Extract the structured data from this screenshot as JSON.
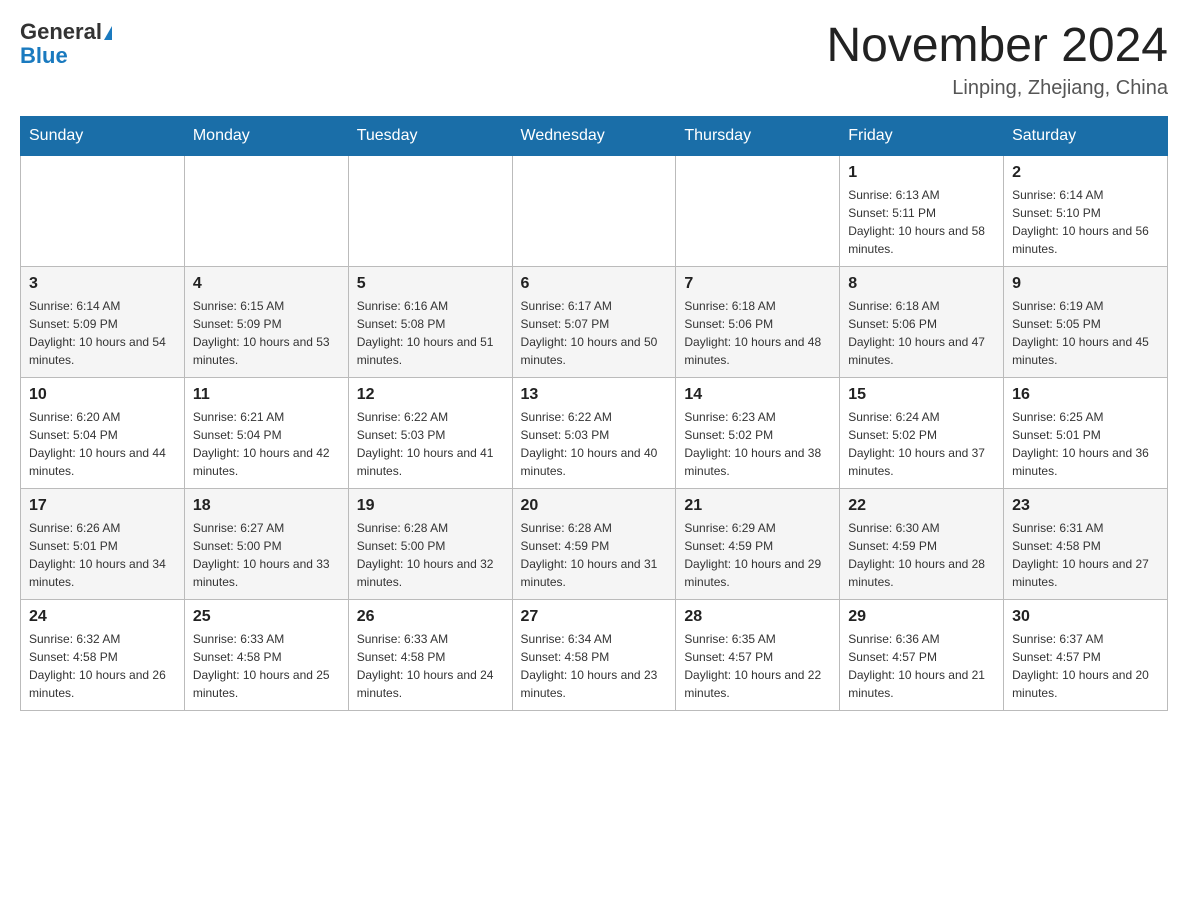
{
  "header": {
    "logo_general": "General",
    "logo_blue": "Blue",
    "month_title": "November 2024",
    "location": "Linping, Zhejiang, China"
  },
  "weekdays": [
    "Sunday",
    "Monday",
    "Tuesday",
    "Wednesday",
    "Thursday",
    "Friday",
    "Saturday"
  ],
  "weeks": [
    [
      {
        "day": "",
        "sunrise": "",
        "sunset": "",
        "daylight": ""
      },
      {
        "day": "",
        "sunrise": "",
        "sunset": "",
        "daylight": ""
      },
      {
        "day": "",
        "sunrise": "",
        "sunset": "",
        "daylight": ""
      },
      {
        "day": "",
        "sunrise": "",
        "sunset": "",
        "daylight": ""
      },
      {
        "day": "",
        "sunrise": "",
        "sunset": "",
        "daylight": ""
      },
      {
        "day": "1",
        "sunrise": "Sunrise: 6:13 AM",
        "sunset": "Sunset: 5:11 PM",
        "daylight": "Daylight: 10 hours and 58 minutes."
      },
      {
        "day": "2",
        "sunrise": "Sunrise: 6:14 AM",
        "sunset": "Sunset: 5:10 PM",
        "daylight": "Daylight: 10 hours and 56 minutes."
      }
    ],
    [
      {
        "day": "3",
        "sunrise": "Sunrise: 6:14 AM",
        "sunset": "Sunset: 5:09 PM",
        "daylight": "Daylight: 10 hours and 54 minutes."
      },
      {
        "day": "4",
        "sunrise": "Sunrise: 6:15 AM",
        "sunset": "Sunset: 5:09 PM",
        "daylight": "Daylight: 10 hours and 53 minutes."
      },
      {
        "day": "5",
        "sunrise": "Sunrise: 6:16 AM",
        "sunset": "Sunset: 5:08 PM",
        "daylight": "Daylight: 10 hours and 51 minutes."
      },
      {
        "day": "6",
        "sunrise": "Sunrise: 6:17 AM",
        "sunset": "Sunset: 5:07 PM",
        "daylight": "Daylight: 10 hours and 50 minutes."
      },
      {
        "day": "7",
        "sunrise": "Sunrise: 6:18 AM",
        "sunset": "Sunset: 5:06 PM",
        "daylight": "Daylight: 10 hours and 48 minutes."
      },
      {
        "day": "8",
        "sunrise": "Sunrise: 6:18 AM",
        "sunset": "Sunset: 5:06 PM",
        "daylight": "Daylight: 10 hours and 47 minutes."
      },
      {
        "day": "9",
        "sunrise": "Sunrise: 6:19 AM",
        "sunset": "Sunset: 5:05 PM",
        "daylight": "Daylight: 10 hours and 45 minutes."
      }
    ],
    [
      {
        "day": "10",
        "sunrise": "Sunrise: 6:20 AM",
        "sunset": "Sunset: 5:04 PM",
        "daylight": "Daylight: 10 hours and 44 minutes."
      },
      {
        "day": "11",
        "sunrise": "Sunrise: 6:21 AM",
        "sunset": "Sunset: 5:04 PM",
        "daylight": "Daylight: 10 hours and 42 minutes."
      },
      {
        "day": "12",
        "sunrise": "Sunrise: 6:22 AM",
        "sunset": "Sunset: 5:03 PM",
        "daylight": "Daylight: 10 hours and 41 minutes."
      },
      {
        "day": "13",
        "sunrise": "Sunrise: 6:22 AM",
        "sunset": "Sunset: 5:03 PM",
        "daylight": "Daylight: 10 hours and 40 minutes."
      },
      {
        "day": "14",
        "sunrise": "Sunrise: 6:23 AM",
        "sunset": "Sunset: 5:02 PM",
        "daylight": "Daylight: 10 hours and 38 minutes."
      },
      {
        "day": "15",
        "sunrise": "Sunrise: 6:24 AM",
        "sunset": "Sunset: 5:02 PM",
        "daylight": "Daylight: 10 hours and 37 minutes."
      },
      {
        "day": "16",
        "sunrise": "Sunrise: 6:25 AM",
        "sunset": "Sunset: 5:01 PM",
        "daylight": "Daylight: 10 hours and 36 minutes."
      }
    ],
    [
      {
        "day": "17",
        "sunrise": "Sunrise: 6:26 AM",
        "sunset": "Sunset: 5:01 PM",
        "daylight": "Daylight: 10 hours and 34 minutes."
      },
      {
        "day": "18",
        "sunrise": "Sunrise: 6:27 AM",
        "sunset": "Sunset: 5:00 PM",
        "daylight": "Daylight: 10 hours and 33 minutes."
      },
      {
        "day": "19",
        "sunrise": "Sunrise: 6:28 AM",
        "sunset": "Sunset: 5:00 PM",
        "daylight": "Daylight: 10 hours and 32 minutes."
      },
      {
        "day": "20",
        "sunrise": "Sunrise: 6:28 AM",
        "sunset": "Sunset: 4:59 PM",
        "daylight": "Daylight: 10 hours and 31 minutes."
      },
      {
        "day": "21",
        "sunrise": "Sunrise: 6:29 AM",
        "sunset": "Sunset: 4:59 PM",
        "daylight": "Daylight: 10 hours and 29 minutes."
      },
      {
        "day": "22",
        "sunrise": "Sunrise: 6:30 AM",
        "sunset": "Sunset: 4:59 PM",
        "daylight": "Daylight: 10 hours and 28 minutes."
      },
      {
        "day": "23",
        "sunrise": "Sunrise: 6:31 AM",
        "sunset": "Sunset: 4:58 PM",
        "daylight": "Daylight: 10 hours and 27 minutes."
      }
    ],
    [
      {
        "day": "24",
        "sunrise": "Sunrise: 6:32 AM",
        "sunset": "Sunset: 4:58 PM",
        "daylight": "Daylight: 10 hours and 26 minutes."
      },
      {
        "day": "25",
        "sunrise": "Sunrise: 6:33 AM",
        "sunset": "Sunset: 4:58 PM",
        "daylight": "Daylight: 10 hours and 25 minutes."
      },
      {
        "day": "26",
        "sunrise": "Sunrise: 6:33 AM",
        "sunset": "Sunset: 4:58 PM",
        "daylight": "Daylight: 10 hours and 24 minutes."
      },
      {
        "day": "27",
        "sunrise": "Sunrise: 6:34 AM",
        "sunset": "Sunset: 4:58 PM",
        "daylight": "Daylight: 10 hours and 23 minutes."
      },
      {
        "day": "28",
        "sunrise": "Sunrise: 6:35 AM",
        "sunset": "Sunset: 4:57 PM",
        "daylight": "Daylight: 10 hours and 22 minutes."
      },
      {
        "day": "29",
        "sunrise": "Sunrise: 6:36 AM",
        "sunset": "Sunset: 4:57 PM",
        "daylight": "Daylight: 10 hours and 21 minutes."
      },
      {
        "day": "30",
        "sunrise": "Sunrise: 6:37 AM",
        "sunset": "Sunset: 4:57 PM",
        "daylight": "Daylight: 10 hours and 20 minutes."
      }
    ]
  ]
}
